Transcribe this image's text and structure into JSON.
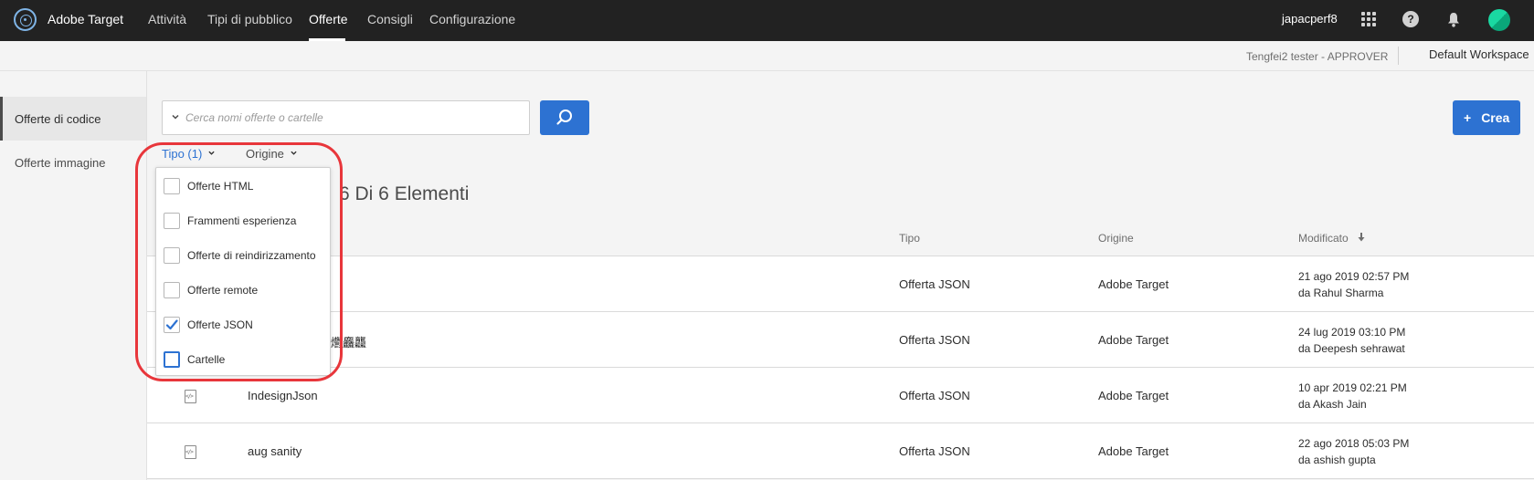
{
  "topbar": {
    "brand": "Adobe Target",
    "nav": [
      "Attività",
      "Tipi di pubblico",
      "Offerte",
      "Consigli",
      "Configurazione"
    ],
    "active_nav": "Offerte",
    "user": "japacperf8"
  },
  "subheader": {
    "role": "Tengfei2 tester - APPROVER",
    "workspace": "Default Workspace"
  },
  "sidebar": {
    "items": [
      {
        "label": "Offerte di codice",
        "active": true
      },
      {
        "label": "Offerte immagine",
        "active": false
      }
    ]
  },
  "search": {
    "placeholder": "Cerca nomi offerte o cartelle",
    "value": ""
  },
  "create_button": {
    "plus": "+",
    "label": "Crea"
  },
  "filters": {
    "tipo": "Tipo (1)",
    "origine": "Origine"
  },
  "count_title": "6 Di 6 Elementi",
  "table": {
    "columns": {
      "tipo": "Tipo",
      "origine": "Origine",
      "modificato": "Modificato"
    },
    "rows": [
      {
        "name": "",
        "type": "Offerta JSON",
        "origin": "Adobe Target",
        "date": "21 ago 2019   02:57 PM",
        "by": "da Rahul Sharma"
      },
      {
        "name": "靐齉齾龘龖龗鱻爩麤龘",
        "type": "Offerta JSON",
        "origin": "Adobe Target",
        "date": "24 lug 2019   03:10 PM",
        "by": "da Deepesh sehrawat"
      },
      {
        "name": "IndesignJson",
        "type": "Offerta JSON",
        "origin": "Adobe Target",
        "date": "10 apr 2019   02:21 PM",
        "by": "da Akash Jain"
      },
      {
        "name": "aug sanity",
        "type": "Offerta JSON",
        "origin": "Adobe Target",
        "date": "22 ago 2018   05:03 PM",
        "by": "da ashish gupta"
      }
    ]
  },
  "dropdown": {
    "items": [
      {
        "label": "Offerte HTML",
        "checked": false
      },
      {
        "label": "Frammenti esperienza",
        "checked": false
      },
      {
        "label": "Offerte di reindirizzamento",
        "checked": false
      },
      {
        "label": "Offerte remote",
        "checked": false
      },
      {
        "label": "Offerte JSON",
        "checked": true
      },
      {
        "label": "Cartelle",
        "checked": false
      }
    ]
  },
  "colors": {
    "accent": "#2d72d2",
    "topbar": "#222222",
    "highlight": "#e8363b"
  }
}
